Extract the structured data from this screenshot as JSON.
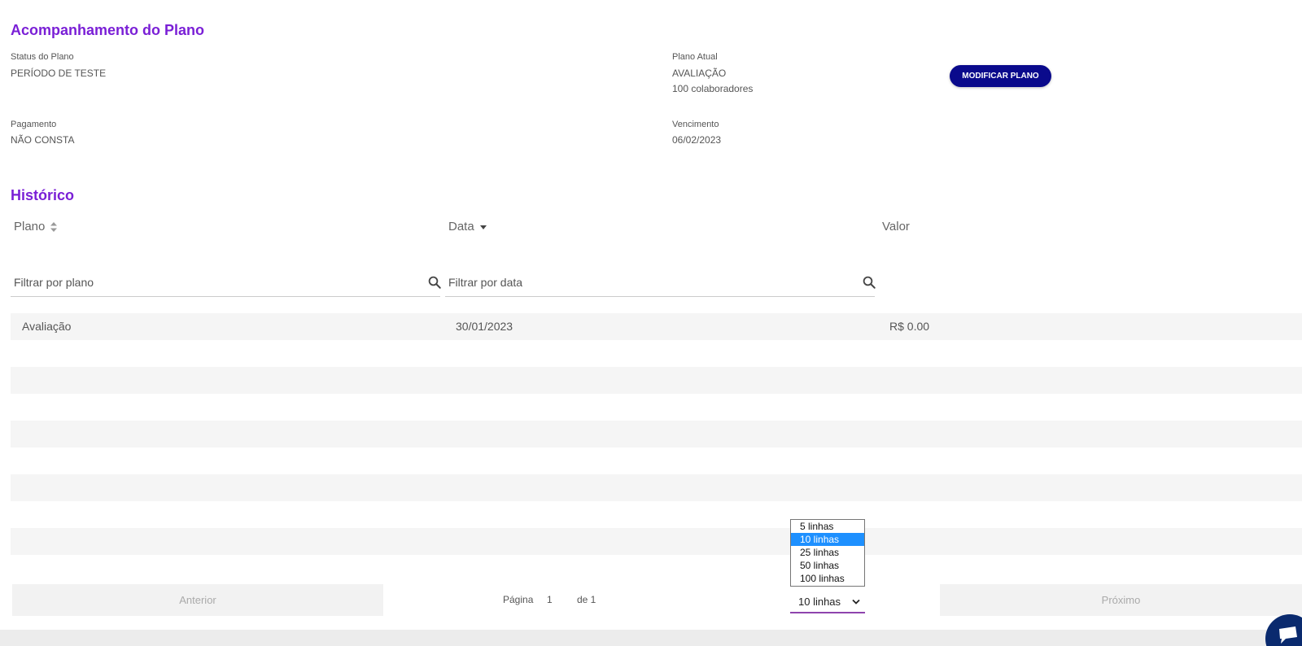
{
  "plan": {
    "title": "Acompanhamento do Plano",
    "status_label": "Status do Plano",
    "status_value": "PERÍODO DE TESTE",
    "current_label": "Plano Atual",
    "current_value": "AVALIAÇÃO",
    "current_sub": "100 colaboradores",
    "modify_button": "MODIFICAR PLANO",
    "payment_label": "Pagamento",
    "payment_value": "NÃO CONSTA",
    "due_label": "Vencimento",
    "due_value": "06/02/2023"
  },
  "history": {
    "title": "Histórico",
    "columns": [
      "Plano",
      "Data",
      "Valor"
    ],
    "filter_plan_placeholder": "Filtrar por plano",
    "filter_date_placeholder": "Filtrar por data",
    "rows": [
      {
        "plano": "Avaliação",
        "data": "30/01/2023",
        "valor": "R$ 0.00"
      }
    ]
  },
  "pagination": {
    "prev": "Anterior",
    "next": "Próximo",
    "page_label": "Página",
    "page_value": "1",
    "of_label": "de 1",
    "rows_selected": "10 linhas",
    "rows_options": [
      "5 linhas",
      "10 linhas",
      "25 linhas",
      "50 linhas",
      "100 linhas"
    ]
  },
  "colors": {
    "accent": "#7a1fd6",
    "button": "#0a0a8c",
    "select_highlight": "#1e90ff"
  }
}
